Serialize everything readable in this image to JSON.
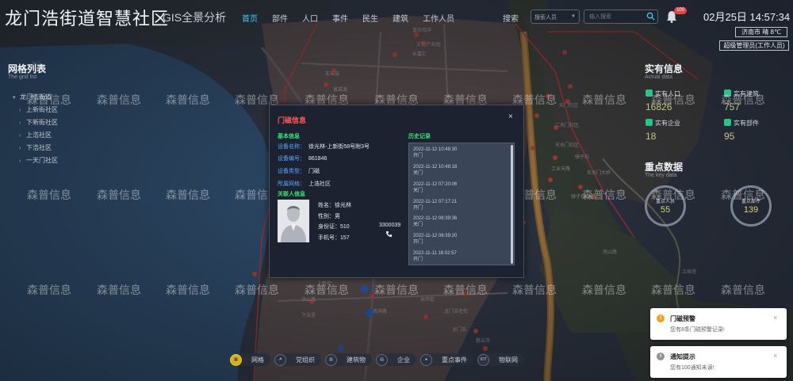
{
  "header": {
    "title": "龙门浩街道智慧社区",
    "subtitle": "GIS全景分析",
    "nav": [
      "首页",
      "部件",
      "人口",
      "事件",
      "民生",
      "建筑",
      "工作人员"
    ],
    "active_nav": "首页",
    "search_label": "搜索",
    "search_select_value": "搜索人员",
    "search_placeholder": "输入搜索",
    "notification_count": "100",
    "datetime": "02月25日 14:57:34",
    "weather": "济南市  晴  8℃",
    "role": "超级管理员(工作人员)"
  },
  "left_panel": {
    "title": "网格列表",
    "subtitle": "The grid list",
    "items": [
      {
        "label": "龙门浩街道",
        "level": 0,
        "chevron": "▾"
      },
      {
        "label": "上新街社区",
        "level": 1,
        "chevron": "›"
      },
      {
        "label": "下新街社区",
        "level": 1,
        "chevron": "›"
      },
      {
        "label": "上浩社区",
        "level": 1,
        "chevron": "›"
      },
      {
        "label": "下浩社区",
        "level": 1,
        "chevron": "›"
      },
      {
        "label": "一天门社区",
        "level": 1,
        "chevron": "›"
      }
    ]
  },
  "right_panel": {
    "title": "实有信息",
    "subtitle": "Actual data",
    "stats": [
      {
        "label": "实有人口",
        "value": "16826"
      },
      {
        "label": "实有建筑",
        "value": "757"
      },
      {
        "label": "实有企业",
        "value": "18"
      },
      {
        "label": "实有部件",
        "value": "95"
      }
    ],
    "key_title": "重点数据",
    "key_subtitle": "The key data",
    "gauges": [
      {
        "label": "重点人员",
        "value": "55"
      },
      {
        "label": "重点部件",
        "value": "139"
      }
    ]
  },
  "watermark": "森普信息",
  "modal": {
    "title": "门磁信息",
    "close": "×",
    "basic_title": "基本信息",
    "fields": [
      {
        "key": "设备名称：",
        "value": "徐光林-上新街58号附3号"
      },
      {
        "key": "设备编号：",
        "value": "861846"
      },
      {
        "key": "设备类型：",
        "value": "门磁"
      },
      {
        "key": "所属网格：",
        "value": "上浩社区"
      }
    ],
    "person_title": "关联人信息",
    "person": {
      "name": "姓名：徐光林",
      "gender": "性别：男",
      "id_label": "身份证：",
      "id_head": "510",
      "id_tail": "3300039",
      "phone": "手机号：157"
    },
    "history_title": "历史记录",
    "history": [
      {
        "time": "2022-11-12 10:48:30",
        "action": "开门"
      },
      {
        "time": "2022-11-12 10:48:18",
        "action": "关门"
      },
      {
        "time": "2022-11-12 07:20:06",
        "action": "关门"
      },
      {
        "time": "2022-11-12 07:17:21",
        "action": "开门"
      },
      {
        "time": "2022-11-12 06:39:36",
        "action": "关门"
      },
      {
        "time": "2022-11-12 06:39:20",
        "action": "开门"
      },
      {
        "time": "2022-11-11 16:02:57",
        "action": "开门"
      }
    ]
  },
  "bottom_nav": [
    {
      "label": "网格",
      "icon": "grid-icon",
      "active": true
    },
    {
      "label": "党组织",
      "icon": "party-icon",
      "active": false
    },
    {
      "label": "建筑物",
      "icon": "building-icon",
      "active": false
    },
    {
      "label": "企业",
      "icon": "enterprise-icon",
      "active": false
    },
    {
      "label": "重点事件",
      "icon": "event-icon",
      "active": false
    },
    {
      "label": "物联网",
      "icon": "iot-icon",
      "active": false
    }
  ],
  "bottom_nav_iot_text": "IOT",
  "toasts": [
    {
      "title": "门磁预警",
      "body": "您有8条门磁预警记录!",
      "icon": "!",
      "color": "#f0a020"
    },
    {
      "title": "通知提示",
      "body": "您有100通知未读!",
      "icon": "i",
      "color": "#909399"
    }
  ],
  "map_labels": [
    "长江",
    "重庆南岸",
    "文化产业园",
    "二天门社区",
    "东水门社区",
    "工业天路",
    "弹子石",
    "南滨路",
    "龙门浩",
    "慈云寺",
    "上新街",
    "涂山路",
    "米市街",
    "玄坛庙",
    "黄葛渡",
    "海棠溪",
    "弹子石街道",
    "龙门浩老街",
    "天门社区",
    "下浩里",
    "东水门大桥",
    "长嘉汇",
    "南山路",
    "文峰塔"
  ]
}
